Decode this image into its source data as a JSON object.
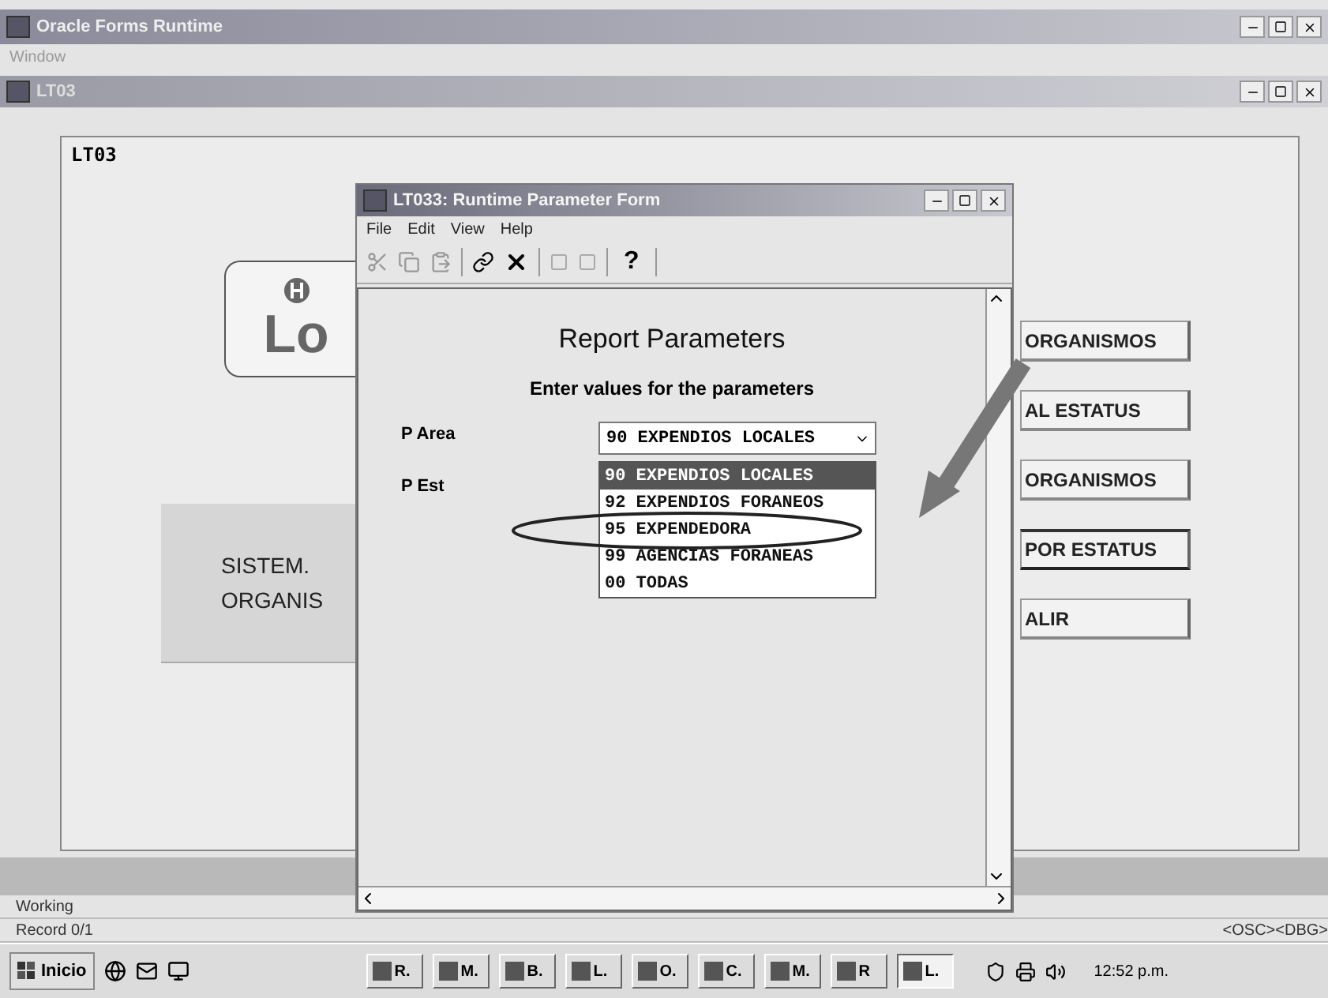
{
  "main_window": {
    "title": "Oracle Forms Runtime"
  },
  "menu": [
    "Window"
  ],
  "child_window": {
    "title": "LT03"
  },
  "form": {
    "frame_label": "LT03",
    "logo_text": "Lo",
    "system_panel": [
      "SISTEM.",
      "ORGANIS"
    ],
    "buttons": [
      {
        "label": "ORGANISMOS",
        "selected": false
      },
      {
        "label": "AL ESTATUS",
        "selected": false
      },
      {
        "label": "ORGANISMOS",
        "selected": false
      },
      {
        "label": "POR ESTATUS",
        "selected": true
      },
      {
        "label": "ALIR",
        "selected": false
      }
    ]
  },
  "dialog": {
    "title": "LT033: Runtime Parameter Form",
    "menu": [
      "File",
      "Edit",
      "View",
      "Help"
    ],
    "help_button": "?",
    "heading": "Report Parameters",
    "subheading": "Enter values for the parameters",
    "fields": [
      {
        "label": "P Area"
      },
      {
        "label": "P Est"
      }
    ],
    "dropdown": {
      "value": "90 EXPENDIOS LOCALES",
      "expanded": true,
      "options": [
        {
          "label": "90 EXPENDIOS LOCALES",
          "selected": true
        },
        {
          "label": "92 EXPENDIOS FORANEOS",
          "selected": false
        },
        {
          "label": "95 EXPENDEDORA",
          "selected": false
        },
        {
          "label": "99 AGENCIAS FORANEAS",
          "selected": false
        },
        {
          "label": "00 TODAS",
          "selected": false
        }
      ]
    }
  },
  "status": {
    "lines": [
      "Working",
      "Record 0/1"
    ],
    "indicators": "<OSC><DBG>"
  },
  "taskbar": {
    "start": "Inicio",
    "tasks": [
      {
        "label": "R.",
        "selected": false
      },
      {
        "label": "M.",
        "selected": false
      },
      {
        "label": "B.",
        "selected": false
      },
      {
        "label": "L.",
        "selected": false
      },
      {
        "label": "O.",
        "selected": false
      },
      {
        "label": "C.",
        "selected": false
      },
      {
        "label": "M.",
        "selected": false
      },
      {
        "label": "R",
        "selected": false
      },
      {
        "label": "L.",
        "selected": true
      }
    ],
    "clock": "12:52 p.m."
  }
}
